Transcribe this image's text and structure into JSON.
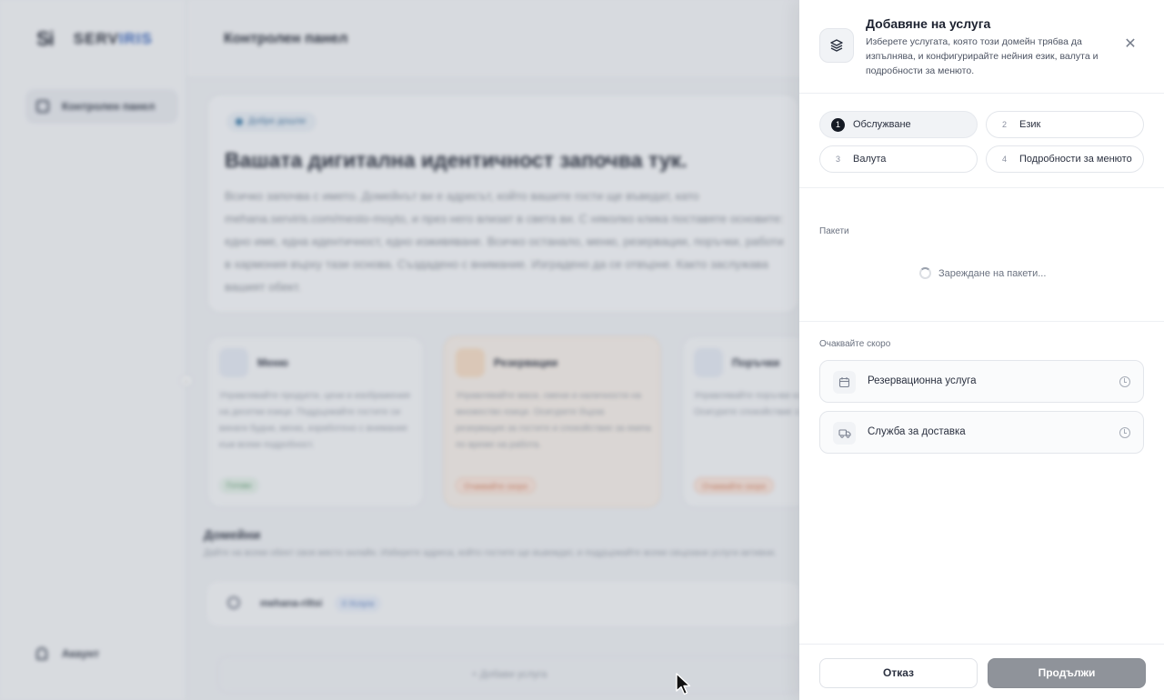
{
  "app": {
    "brand_mark": "Si",
    "brand_name_a": "SERV",
    "brand_name_b": "IRIS",
    "page_title": "Контролен панел",
    "sidebar": {
      "dashboard": "Контролен панел",
      "account": "Акаунт"
    },
    "hero": {
      "badge": "Добре дошли",
      "title": "Вашата дигитална идентичност започва тук.",
      "text": "Всичко започва с името. Домейнът ви е адресът, който вашите гости ще въведат, като mehana.serviris.com/mesto-moyto, и през него влизат в света ви. С няколко клика поставяте основите: едно име, една идентичност, едно изживяване. Всичко останало, меню, резервации, поръчки, работи в хармония върху тази основа. Създадено с внимание. Изградено да се отвърне. Както заслужава вашият обект."
    },
    "features": [
      {
        "title": "Меню",
        "text": "Управлявайте продукти, цени и изображения на десетки езици. Поддържайте гостите си винаги будни, меню, изработено с внимание към всеки подробност.",
        "badge": "Готово"
      },
      {
        "title": "Резервации",
        "text": "Управлявайте маси, смени и наличности на множество езици. Осигурете бърза резервация за гостите и спокойствие за екипа по време на работа.",
        "badge": "Очаквайте скоро"
      },
      {
        "title": "Поръчки",
        "text": "Управлявайте поръчки на едно място. Осигурете спокойствие за екипа за всяка.",
        "badge": "Очаквайте скоро"
      }
    ],
    "domains": {
      "title": "Домейни",
      "subtitle": "Дайте на всеки обект своя място онлайн. Изберете адреса, който гостите ще въвеждат, и поддържайте всеки свързани услуги активни.",
      "domain_name": "mehana-riltsi",
      "services_badge": "0 Услуги",
      "add_service": "+ Добави услуга"
    }
  },
  "drawer": {
    "title": "Добавяне на услуга",
    "description": "Изберете услугата, която този домейн трябва да изпълнява, и конфигурирайте нейния език, валута и подробности за менюто.",
    "close_glyph": "✕",
    "steps": [
      {
        "num": "1",
        "label": "Обслужване",
        "active": true
      },
      {
        "num": "2",
        "label": "Език"
      },
      {
        "num": "3",
        "label": "Валута"
      },
      {
        "num": "4",
        "label": "Подробности за менюто"
      }
    ],
    "packages_label": "Пакети",
    "loading_text": "Зареждане на пакети...",
    "upcoming_label": "Очаквайте скоро",
    "upcoming": [
      {
        "label": "Резервационна услуга",
        "icon": "calendar-icon"
      },
      {
        "label": "Служба за доставка",
        "icon": "truck-icon"
      }
    ],
    "cancel_label": "Отказ",
    "continue_label": "Продължи"
  }
}
